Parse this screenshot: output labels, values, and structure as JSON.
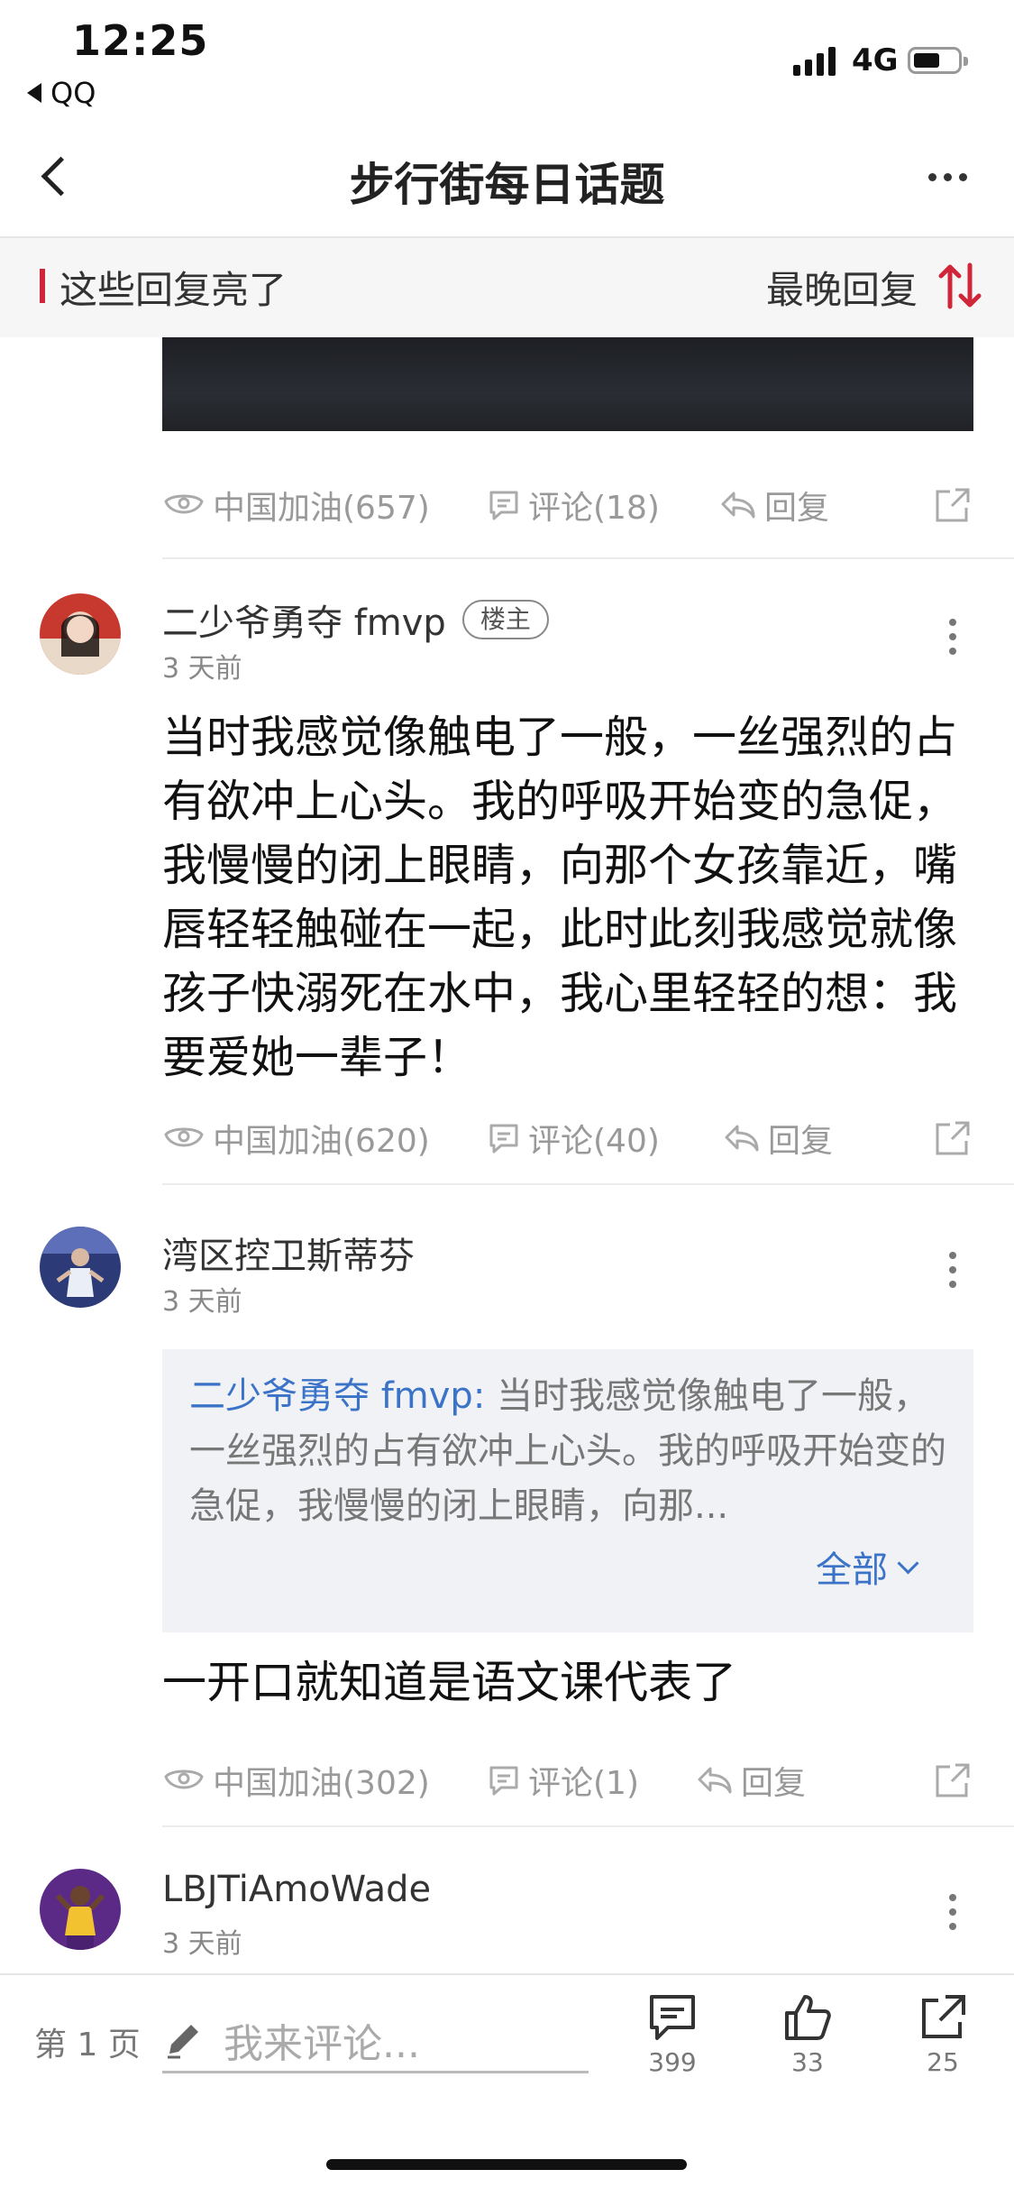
{
  "status_bar": {
    "time": "12:25",
    "back_app": "QQ",
    "network": "4G"
  },
  "nav": {
    "title": "步行街每日话题"
  },
  "section": {
    "title": "这些回复亮了",
    "sort_label": "最晚回复"
  },
  "top_actions": {
    "cheer": "中国加油(657)",
    "comment": "评论(18)",
    "reply": "回复"
  },
  "posts": [
    {
      "username": "二少爷勇夺 fmvp",
      "badge": "楼主",
      "time": "3 天前",
      "text": "当时我感觉像触电了一般，一丝强烈的占有欲冲上心头。我的呼吸开始变的急促，我慢慢的闭上眼睛，向那个女孩靠近，嘴唇轻轻触碰在一起，此时此刻我感觉就像孩子快溺死在水中，我心里轻轻的想：我要爱她一辈子！",
      "cheer": "中国加油(620)",
      "comment": "评论(40)",
      "reply": "回复"
    },
    {
      "username": "湾区控卫斯蒂芬",
      "time": "3 天前",
      "quote_name": "二少爷勇夺 fmvp:",
      "quote_text": " 当时我感觉像触电了一般，一丝强烈的占有欲冲上心头。我的呼吸开始变的急促，我慢慢的闭上眼睛，向那...",
      "quote_all": "全部",
      "text": "一开口就知道是语文课代表了",
      "cheer": "中国加油(302)",
      "comment": "评论(1)",
      "reply": "回复"
    },
    {
      "username": "LBJTiAmoWade",
      "time": "3 天前"
    }
  ],
  "bottom_bar": {
    "page": "第 1 页",
    "placeholder": "我来评论...",
    "comments_count": "399",
    "likes_count": "33",
    "shares_count": "25"
  },
  "colors": {
    "accent_red": "#d0263a",
    "link_blue": "#3a73c7",
    "muted": "#999999"
  }
}
